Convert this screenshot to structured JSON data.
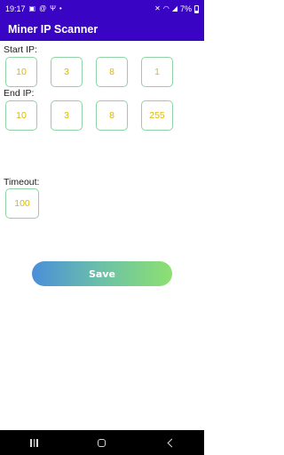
{
  "status_bar": {
    "time": "19:17",
    "battery": "7%",
    "left_icons": [
      "image-icon",
      "at-icon",
      "usb-icon",
      "dot-icon"
    ],
    "right_icons": [
      "mute-icon",
      "wifi-icon",
      "signal-icon",
      "battery-icon"
    ]
  },
  "app_bar": {
    "title": "Miner IP Scanner"
  },
  "start_ip": {
    "label": "Start IP:",
    "octets": [
      "10",
      "3",
      "8",
      "1"
    ]
  },
  "end_ip": {
    "label": "End IP:",
    "octets": [
      "10",
      "3",
      "8",
      "255"
    ]
  },
  "timeout": {
    "label": "Timeout:",
    "value": "100"
  },
  "save_label": "Save",
  "nav_bar": {
    "buttons": [
      "recents-icon",
      "home-icon",
      "back-icon"
    ]
  }
}
